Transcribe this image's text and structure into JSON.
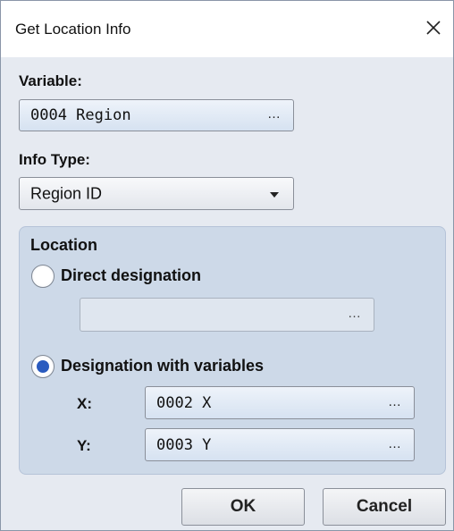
{
  "window": {
    "title": "Get Location Info"
  },
  "variable": {
    "label": "Variable:",
    "value": "0004 Region",
    "browse": "…"
  },
  "info_type": {
    "label": "Info Type:",
    "selected": "Region ID"
  },
  "location": {
    "label": "Location",
    "direct": {
      "label": "Direct designation",
      "selected": false,
      "value": "",
      "browse": "…"
    },
    "with_variables": {
      "label": "Designation with variables",
      "selected": true,
      "x_label": "X:",
      "x_value": "0002 X",
      "y_label": "Y:",
      "y_value": "0003 Y",
      "browse": "…"
    }
  },
  "buttons": {
    "ok": "OK",
    "cancel": "Cancel"
  }
}
